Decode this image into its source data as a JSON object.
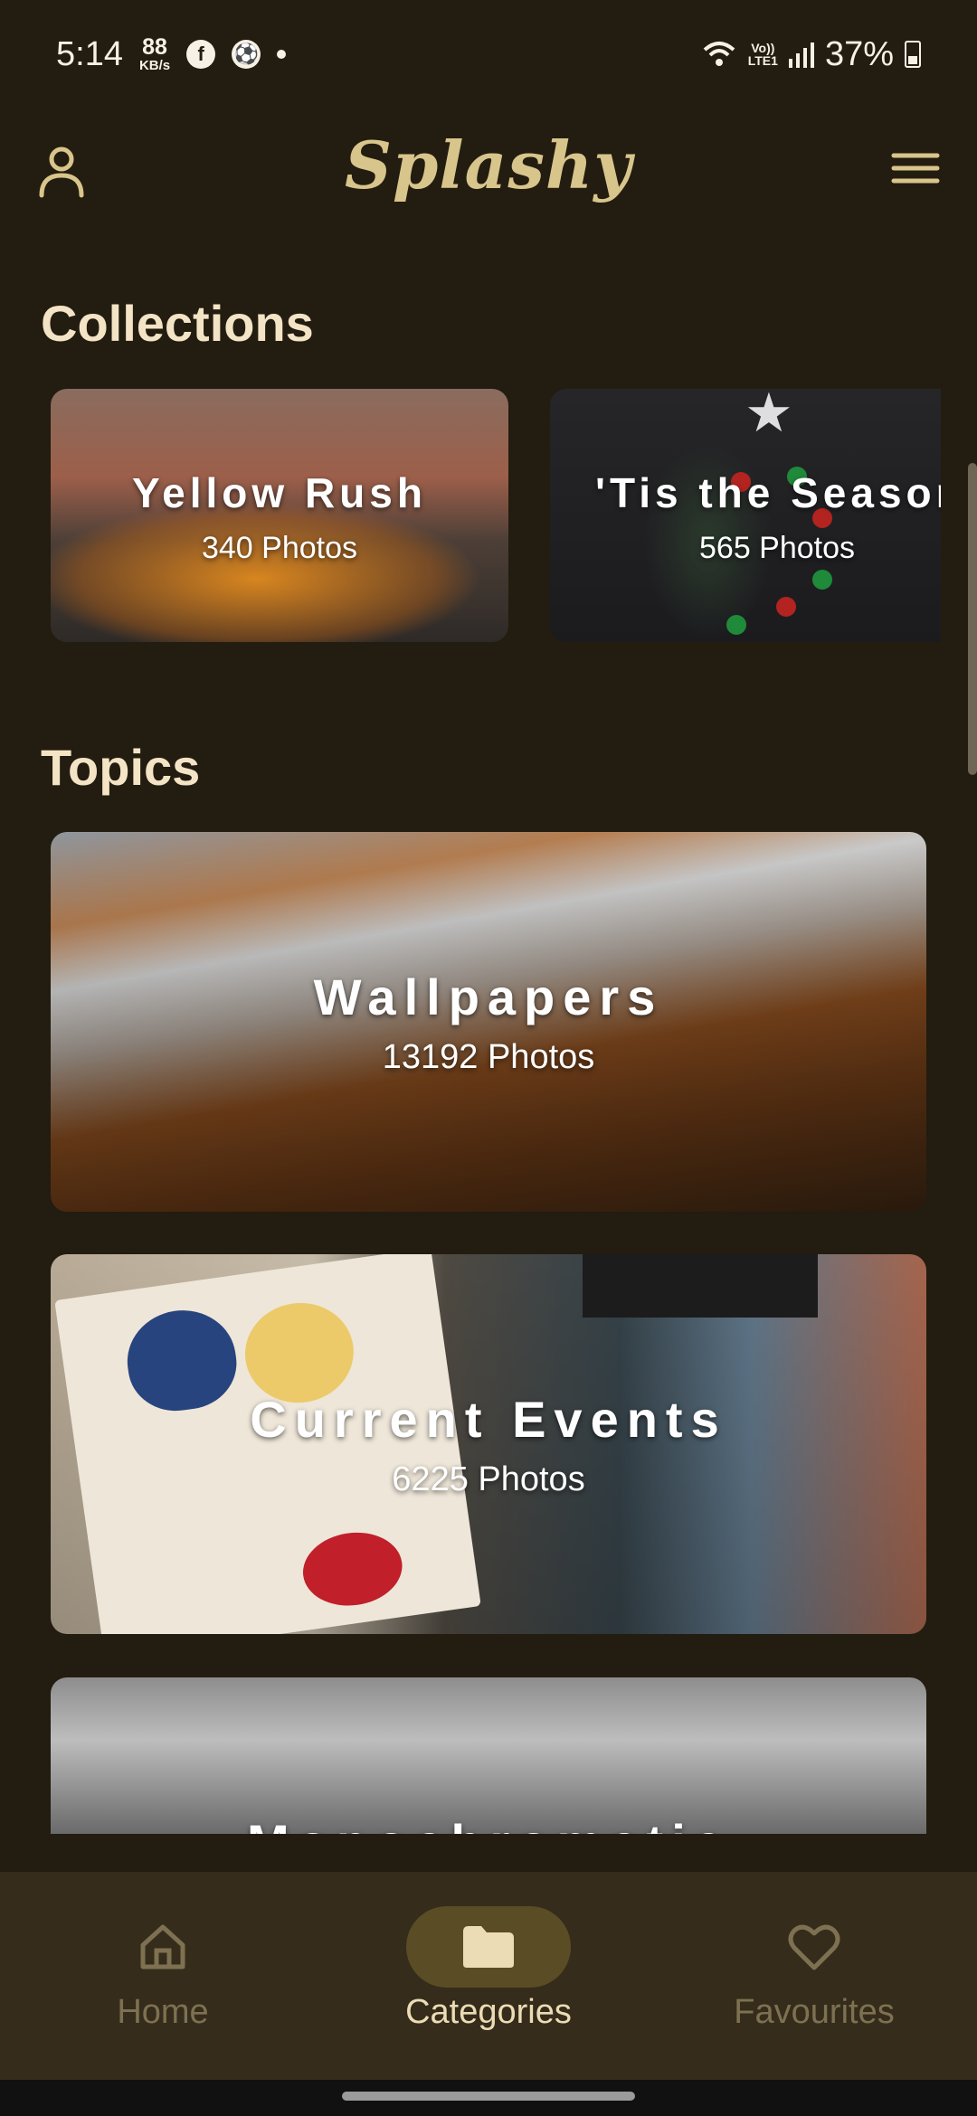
{
  "status_bar": {
    "time": "5:14",
    "net_speed_value": "88",
    "net_speed_unit": "KB/s",
    "lte_label_top": "Vo))",
    "lte_label_bottom": "LTE1",
    "battery": "37%"
  },
  "app_bar": {
    "title": "Splashy"
  },
  "collections": {
    "heading": "Collections",
    "items": [
      {
        "title": "Yellow Rush",
        "count": "340 Photos"
      },
      {
        "title": "'Tis the Season",
        "count": "565 Photos"
      }
    ]
  },
  "topics": {
    "heading": "Topics",
    "items": [
      {
        "title": "Wallpapers",
        "count": "13192 Photos"
      },
      {
        "title": "Current Events",
        "count": "6225 Photos"
      },
      {
        "title": "Monochromatic"
      }
    ]
  },
  "bottom_nav": {
    "items": [
      {
        "label": "Home",
        "icon": "home-icon",
        "active": false
      },
      {
        "label": "Categories",
        "icon": "folder-icon",
        "active": true
      },
      {
        "label": "Favourites",
        "icon": "heart-icon",
        "active": false
      }
    ]
  },
  "colors": {
    "background": "#231c10",
    "accent": "#d8c58b",
    "nav_background": "#352c1b",
    "active_pill": "#5a4c25"
  }
}
